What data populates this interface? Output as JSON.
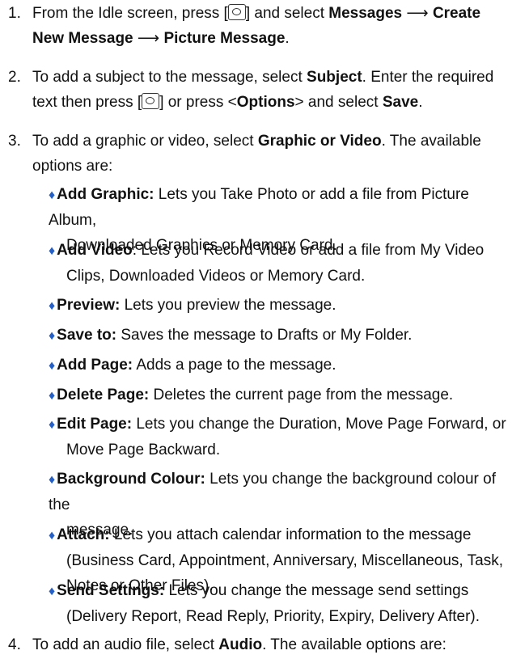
{
  "steps": [
    {
      "num": "1.",
      "l1a": "From the Idle screen, press [",
      "l1b": "] and select ",
      "l1c": "Messages",
      "arrow": "⟶",
      "l1d": "Create",
      "l2a": "New Message",
      "l2b": "Picture Message",
      "l2c": "."
    },
    {
      "num": "2.",
      "l1a": "To add a subject to the message, select ",
      "l1b": "Subject",
      "l1c": ". Enter the required",
      "l2a": "text then press [",
      "l2b": "] or press <",
      "l2c": "Options",
      "l2d": "> and select ",
      "l2e": "Save",
      "l2f": "."
    },
    {
      "num": "3.",
      "l1a": "To add a graphic or video, select ",
      "l1b": "Graphic or Video",
      "l1c": ". The available",
      "l2": "options are:"
    },
    {
      "num": "4.",
      "a": "To add an audio file, select ",
      "b": "Audio",
      "c": ". The available options are:"
    }
  ],
  "options": [
    {
      "term": "Add Graphic:",
      "rest": " Lets you Take Photo or add a file from Picture Album,",
      "cont": [
        "Downloaded Graphics or Memory Card."
      ]
    },
    {
      "term": "Add Video",
      "rest": ": Lets you Record Video or add a file from My Video",
      "cont": [
        "Clips, Downloaded Videos or Memory Card."
      ]
    },
    {
      "term": "Preview:",
      "rest": " Lets you preview the message.",
      "cont": []
    },
    {
      "term": "Save to:",
      "rest": " Saves the message to Drafts or My Folder.",
      "cont": []
    },
    {
      "term": "Add Page:",
      "rest": " Adds a page to the message.",
      "cont": []
    },
    {
      "term": "Delete Page:",
      "rest": " Deletes the current page from the message.",
      "cont": []
    },
    {
      "term": "Edit Page:",
      "rest": " Lets you change the Duration, Move Page Forward, or",
      "cont": [
        "Move Page Backward."
      ]
    },
    {
      "term": "Background Colour:",
      "rest": " Lets you change the background colour of the",
      "cont": [
        "message."
      ]
    },
    {
      "term": "Attach:",
      "rest": " Lets you attach calendar information to the message",
      "cont": [
        "(Business Card, Appointment, Anniversary, Miscellaneous, Task,",
        "Notes or Other Files)."
      ]
    },
    {
      "term": "Send Settings:",
      "rest": " Lets you change the message send settings",
      "cont": [
        "(Delivery Report, Read Reply, Priority, Expiry, Delivery After)."
      ]
    }
  ],
  "icons": {
    "bullet": "♦",
    "ok_key": "ok-key-icon"
  },
  "colors": {
    "bullet": "#2560c8",
    "text": "#111111"
  }
}
